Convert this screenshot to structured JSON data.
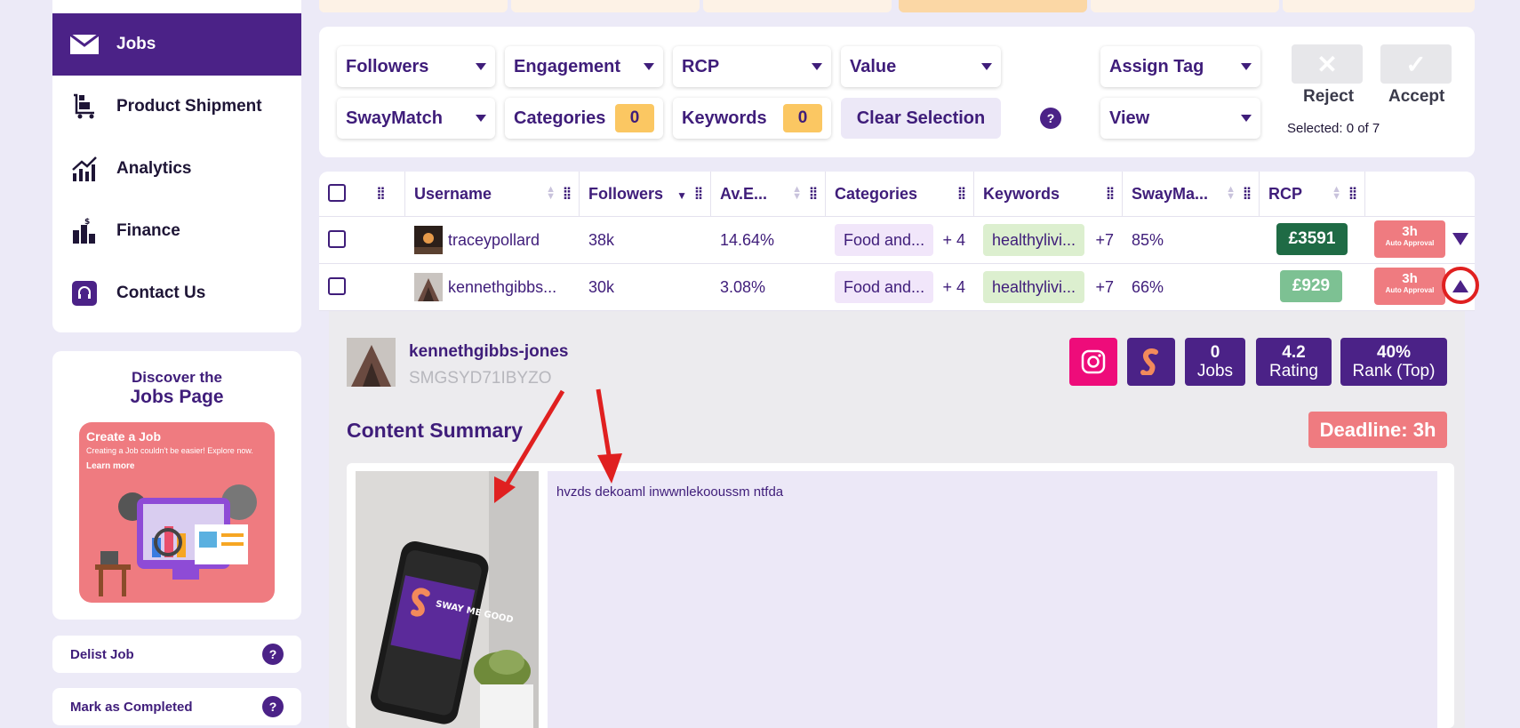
{
  "sidebar": {
    "items": [
      {
        "label": "Jobs",
        "icon": "envelope-icon"
      },
      {
        "label": "Product Shipment",
        "icon": "cart-icon"
      },
      {
        "label": "Analytics",
        "icon": "chart-icon"
      },
      {
        "label": "Finance",
        "icon": "money-icon"
      },
      {
        "label": "Contact Us",
        "icon": "headset-icon"
      }
    ],
    "promo": {
      "title_line1": "Discover the",
      "title_line2": "Jobs Page",
      "banner_title": "Create a Job",
      "banner_text": "Creating a Job couldn't be easier! Explore now.",
      "banner_link": "Learn more"
    },
    "delist_label": "Delist Job",
    "complete_label": "Mark as Completed",
    "help": "?"
  },
  "filters": {
    "followers": "Followers",
    "engagement": "Engagement",
    "rcp": "RCP",
    "value": "Value",
    "assign_tag": "Assign Tag",
    "swaymatch": "SwayMatch",
    "categories": "Categories",
    "categories_count": "0",
    "keywords": "Keywords",
    "keywords_count": "0",
    "clear_selection": "Clear Selection",
    "help": "?",
    "view": "View",
    "reject": "Reject",
    "accept": "Accept",
    "selected": "Selected: 0 of 7"
  },
  "table": {
    "headers": {
      "username": "Username",
      "followers": "Followers",
      "engagement": "Av.E...",
      "categories": "Categories",
      "keywords": "Keywords",
      "swaymatch": "SwayMa...",
      "rcp": "RCP"
    },
    "rows": [
      {
        "username": "traceypollard",
        "followers": "38k",
        "engagement": "14.64%",
        "category": "Food and...",
        "category_more": "+ 4",
        "keyword": "healthylivi...",
        "keyword_more": "+7",
        "swaymatch": "85%",
        "rcp": "£3591",
        "rcp_color": "#1f6b45",
        "approval_time": "3h",
        "approval_label": "Auto Approval"
      },
      {
        "username": "kennethgibbs...",
        "followers": "30k",
        "engagement": "3.08%",
        "category": "Food and...",
        "category_more": "+ 4",
        "keyword": "healthylivi...",
        "keyword_more": "+7",
        "swaymatch": "66%",
        "rcp": "£929",
        "rcp_color": "#7dc193",
        "approval_time": "3h",
        "approval_label": "Auto Approval"
      }
    ]
  },
  "detail": {
    "name": "kennethgibbs-jones",
    "code": "SMGSYD71IBYZO",
    "jobs_value": "0",
    "jobs_label": "Jobs",
    "rating_value": "4.2",
    "rating_label": "Rating",
    "rank_value": "40%",
    "rank_label": "Rank (Top)",
    "content_title": "Content Summary",
    "deadline": "Deadline: 3h",
    "caption": "hvzds dekoaml inwwnlekooussm ntfda",
    "photo_text": "SWAY ME GOOD"
  },
  "colors": {
    "brand_purple": "#4b2287",
    "accent_red": "#ef7b80",
    "instagram": "#ee0c7a",
    "annotation_red": "#e02020"
  }
}
